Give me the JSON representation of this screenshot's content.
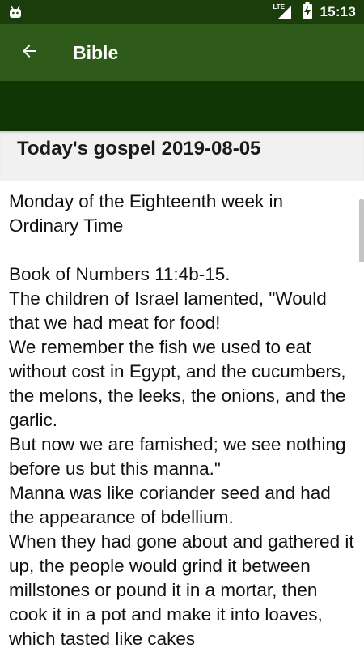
{
  "status_bar": {
    "time": "15:13",
    "network": "LTE",
    "icons": [
      "android-icon",
      "signal-icon",
      "battery-charging-icon"
    ]
  },
  "app_bar": {
    "title": "Bible",
    "back_icon": "arrow-left-icon"
  },
  "page": {
    "heading": "Today's gospel 2019-08-05",
    "text": "Monday of the Eighteenth week in Ordinary Time\n\nBook of Numbers 11:4b-15.\nThe children of Israel lamented, \"Would that we had meat for food!\nWe remember the fish we used to eat without cost in Egypt, and the cucumbers, the melons, the leeks, the onions, and the garlic.\nBut now we are famished; we see nothing before us but this manna.\"\nManna was like coriander seed and had the appearance of bdellium.\nWhen they had gone about and gathered it up, the people would grind it between millstones or pound it in a mortar, then cook it in a pot and make it into loaves, which tasted like cakes"
  },
  "colors": {
    "status_bar": "#1b3d0b",
    "app_bar": "#2e5a1a",
    "sub_bar": "#113405",
    "header_band": "#f1f1f1"
  }
}
